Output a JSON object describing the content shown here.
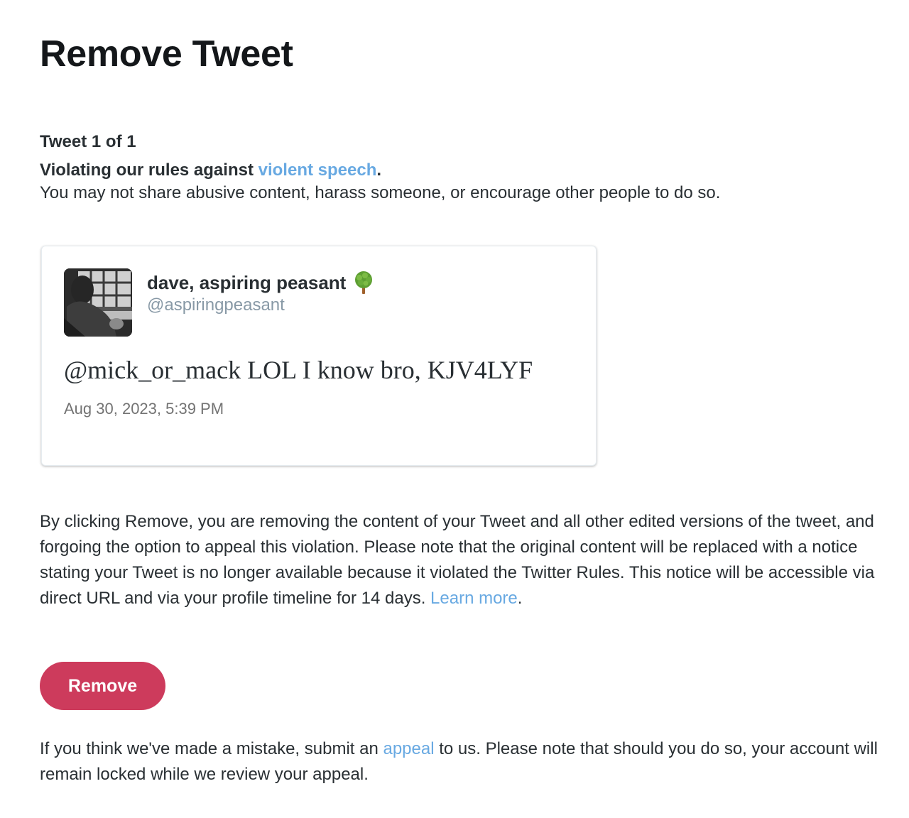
{
  "page": {
    "title": "Remove Tweet"
  },
  "violation": {
    "tweet_count": "Tweet 1 of 1",
    "rule_prefix": "Violating our rules against ",
    "rule_link": "violent speech",
    "rule_suffix": ".",
    "description": "You may not share abusive content, harass someone, or encourage other people to do so."
  },
  "tweet": {
    "display_name": "dave, aspiring peasant",
    "name_emoji_icon": "deciduous-tree-icon",
    "handle": "@aspiringpeasant",
    "text": "@mick_or_mack LOL I know bro, KJV4LYF",
    "timestamp": "Aug 30, 2023, 5:39 PM"
  },
  "removal_notice": {
    "text": "By clicking Remove, you are removing the content of your Tweet and all other edited versions of the tweet, and forgoing the option to appeal this violation. Please note that the original content will be replaced with a notice stating your Tweet is no longer available because it violated the Twitter Rules. This notice will be accessible via direct URL and via your profile timeline for 14 days. ",
    "learn_more_link": "Learn more",
    "suffix": "."
  },
  "actions": {
    "remove_label": "Remove"
  },
  "appeal_notice": {
    "prefix": "If you think we've made a mistake, submit an ",
    "appeal_link": "appeal",
    "suffix": " to us. Please note that should you do so, your account will remain locked while we review your appeal."
  },
  "colors": {
    "link": "#68a9e2",
    "remove_button": "#cd3b5c",
    "text": "#292f33",
    "handle": "#8899a6"
  }
}
